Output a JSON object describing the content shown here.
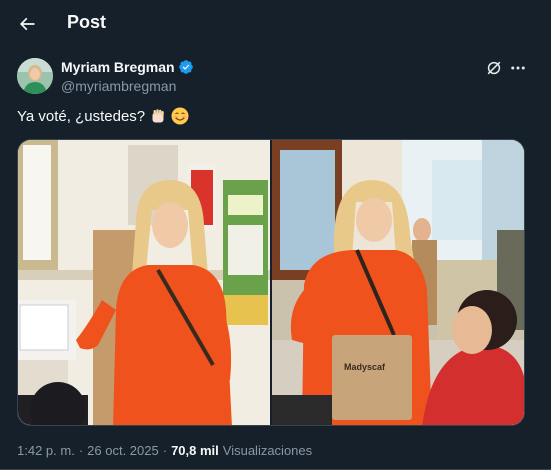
{
  "header": {
    "title": "Post"
  },
  "author": {
    "name": "Myriam Bregman",
    "handle": "@myriambregman"
  },
  "tweet": {
    "text": "Ya voté, ¿ustedes?"
  },
  "media": {
    "photos": [
      {
        "label": "photo-1"
      },
      {
        "label": "photo-2",
        "bag_text": "Madyscaf"
      }
    ]
  },
  "footer": {
    "time": "1:42 p. m.",
    "separator": "·",
    "date": "26 oct. 2025",
    "views_count": "70,8 mil",
    "views_label": "Visualizaciones"
  },
  "colors": {
    "background": "#15202b",
    "verified": "#1d9bf0",
    "shirt": "#f0521d"
  }
}
